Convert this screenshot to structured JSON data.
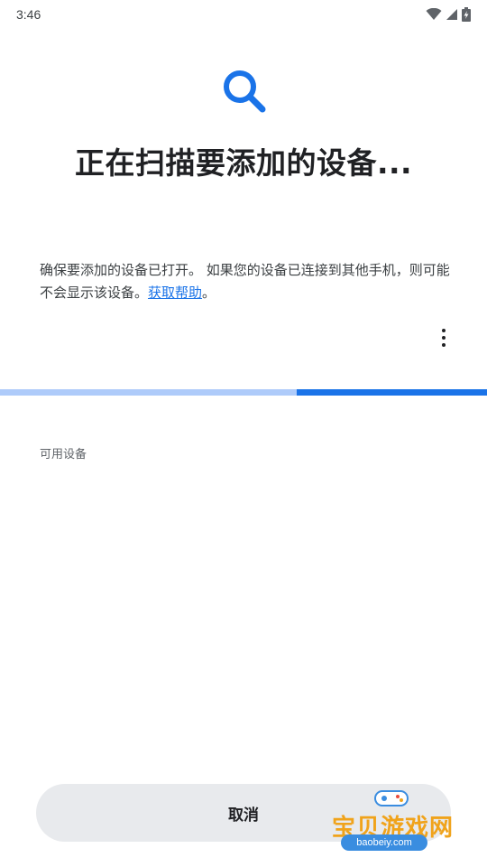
{
  "status_bar": {
    "time": "3:46"
  },
  "header": {
    "title": "正在扫描要添加的设备..."
  },
  "description": {
    "text": "确保要添加的设备已打开。 如果您的设备已连接到其他手机，则可能不会显示该设备。",
    "link_label": "获取帮助",
    "trailing": "。"
  },
  "progress": {
    "fraction": 0.61,
    "track_color": "#aecbfa",
    "fill_color": "#1a73e8"
  },
  "section": {
    "available_devices_label": "可用设备"
  },
  "actions": {
    "cancel_label": "取消"
  },
  "watermark": {
    "brand": "宝贝游戏网",
    "url": "baobeiy.com"
  },
  "colors": {
    "accent": "#1a73e8"
  }
}
